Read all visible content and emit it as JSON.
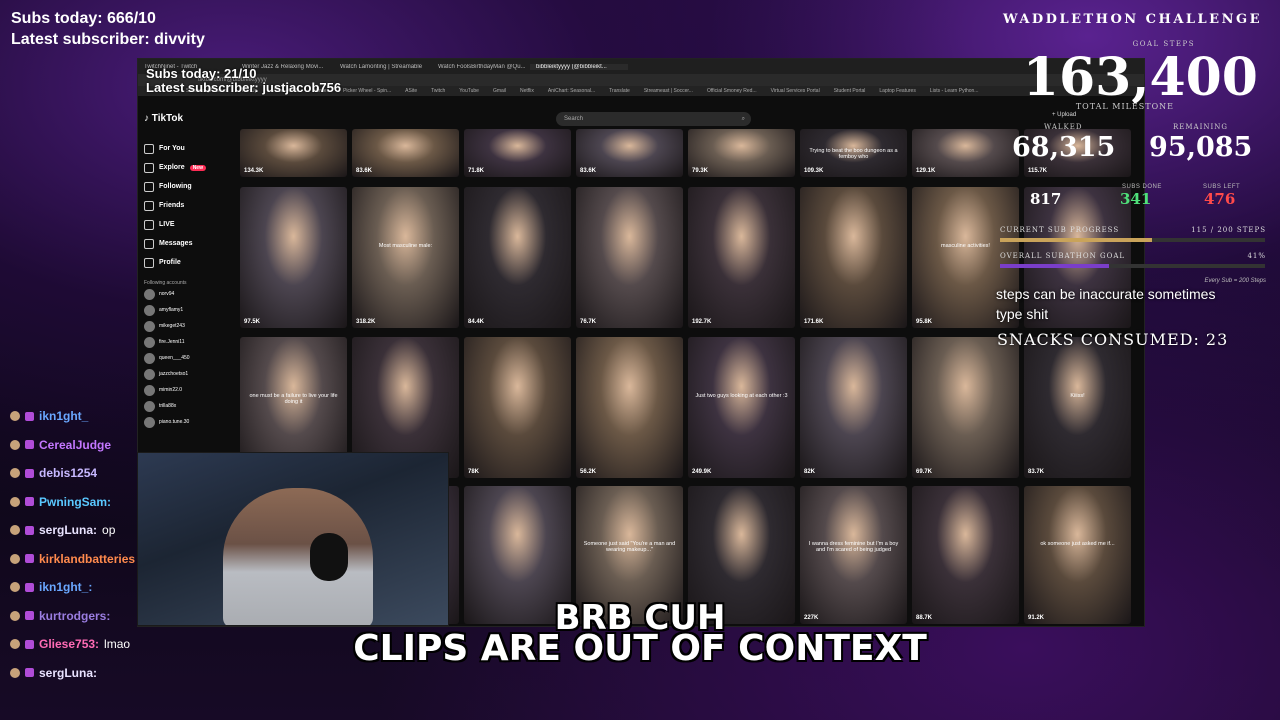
{
  "stream": {
    "subs_today": "Subs today: 666/10",
    "latest_subscriber": "Latest subscriber: divvity"
  },
  "browser": {
    "tabs": [
      "TwitchNinet - Twitch",
      "Winter Jazz & Relaxing Movi...",
      "Watch Lamonting | Streamable",
      "Watch FoolsBirthdayMan @Qu...",
      "bibbleiktyyyy (@bibbleikt..."
    ],
    "address": "tiktok.com/@bibbleiktyyyy",
    "bookmarks": [
      "Sthermal | Account",
      "RunUp",
      "Voice - Calls",
      "Movies",
      "Picker Wheel - Spin...",
      "ASite",
      "Twitch",
      "YouTube",
      "Gmail",
      "Netflix",
      "AniChart: Seasonal...",
      "Translate",
      "Streameast | Soccer...",
      "Official Smoney Red...",
      "Virtual Services Portal",
      "Student Portal",
      "Laptop Features",
      "Lists - Learn Python..."
    ],
    "overlay_subs_today": "Subs today: 21/10",
    "overlay_latest_subscriber": "Latest subscriber: justjacob756"
  },
  "tiktok": {
    "logo": "TikTok",
    "search_placeholder": "Search",
    "upload": "+ Upload",
    "nav": [
      {
        "label": "For You",
        "icon": "home-icon"
      },
      {
        "label": "Explore",
        "icon": "compass-icon",
        "badge": "New"
      },
      {
        "label": "Following",
        "icon": "following-icon"
      },
      {
        "label": "Friends",
        "icon": "friends-icon"
      },
      {
        "label": "LIVE",
        "icon": "live-icon"
      },
      {
        "label": "Messages",
        "icon": "messages-icon"
      },
      {
        "label": "Profile",
        "icon": "profile-icon"
      }
    ],
    "following_header": "Following accounts",
    "accounts": [
      "norv94",
      "amyflamy1",
      "mikeget243",
      "fire.Jenni11",
      "queen___450",
      "jazzchoetso1",
      "mimin22.0",
      "trilla88x",
      "piano.tune.30"
    ],
    "rows": [
      [
        "134.3K",
        "83.6K",
        "71.8K",
        "83.6K",
        "79.3K",
        "109.3K",
        "129.1K",
        "115.7K"
      ],
      [
        "97.5K",
        "318.2K",
        "84.4K",
        "76.7K",
        "192.7K",
        "171.6K",
        "95.8K",
        ""
      ],
      [
        "",
        "",
        "78K",
        "56.2K",
        "249.9K",
        "82K",
        "69.7K",
        "83.7K"
      ],
      [
        "",
        "",
        "",
        "",
        "",
        "227K",
        "88.7K",
        "91.2K"
      ]
    ],
    "captions": {
      "r0c5": "Trying to beat the boo dungeon as a femboy who",
      "r1c1": "Most masculine male:",
      "r1c6": "masculine activities!",
      "r2c0": "one must be a failure to live your life doing it",
      "r2c4": "Just two guys looking at each other :3",
      "r2c7": "Kiiiss!",
      "r3c3": "Someone just said \"You're a man and wearing makeup...\"",
      "r3c5": "I wanna dress feminine but I'm a boy and I'm scared of being judged",
      "r3c7": "ok someone just asked me if..."
    }
  },
  "chat": [
    {
      "user": "ikn1ght_",
      "color": "#6aa7ff",
      "msg": ""
    },
    {
      "user": "CerealJudge",
      "color": "#c377ff",
      "msg": ""
    },
    {
      "user": "debis1254",
      "color": "#c7b8ff",
      "msg": ""
    },
    {
      "user": "PwningSam:",
      "color": "#5ac8ff",
      "msg": ""
    },
    {
      "user": "sergLuna:",
      "color": "#e9e3ff",
      "msg": "op"
    },
    {
      "user": "kirklandbatteries",
      "color": "#ff8a4d",
      "msg": ""
    },
    {
      "user": "ikn1ght_:",
      "color": "#6aa7ff",
      "msg": ""
    },
    {
      "user": "kurtrodgers:",
      "color": "#9a7de0",
      "msg": ""
    },
    {
      "user": "Gliese753:",
      "color": "#ff6bb5",
      "msg": "lmao"
    },
    {
      "user": "sergLuna:",
      "color": "#e9e3ff",
      "msg": ""
    }
  ],
  "challenge": {
    "title": "WADDLETHON CHALLENGE",
    "goal_label": "GOAL STEPS",
    "goal_steps": "163,400",
    "milestone_label": "TOTAL MILESTONE",
    "walked_label": "WALKED",
    "walked": "68,315",
    "remaining_label": "REMAINING",
    "remaining": "95,085",
    "count_a": "817",
    "subs_done_label": "SUBS DONE",
    "subs_done": "341",
    "subs_left_label": "SUBS LEFT",
    "subs_left": "476",
    "sub_progress_label": "CURRENT SUB PROGRESS",
    "sub_progress_value": "115 / 200 STEPS",
    "sub_progress_fraction": 0.575,
    "overall_label": "OVERALL SUBATHON GOAL",
    "overall_value": "41%",
    "overall_fraction": 0.41,
    "every_sub_note": "Every Sub = 200 Steps",
    "accent_green": "#4fe07a",
    "accent_red": "#ff4a4a",
    "bar_gold": "#c9a35a",
    "bar_purple": "#7a3ec9"
  },
  "floating_text": {
    "line1": "steps can be inaccurate sometimes",
    "line2": "type shit",
    "snacks": "SNACKS CONSUMED: 23"
  },
  "captions": {
    "line1": "BRB CUH",
    "line2": "CLIPS ARE OUT OF CONTEXT"
  }
}
